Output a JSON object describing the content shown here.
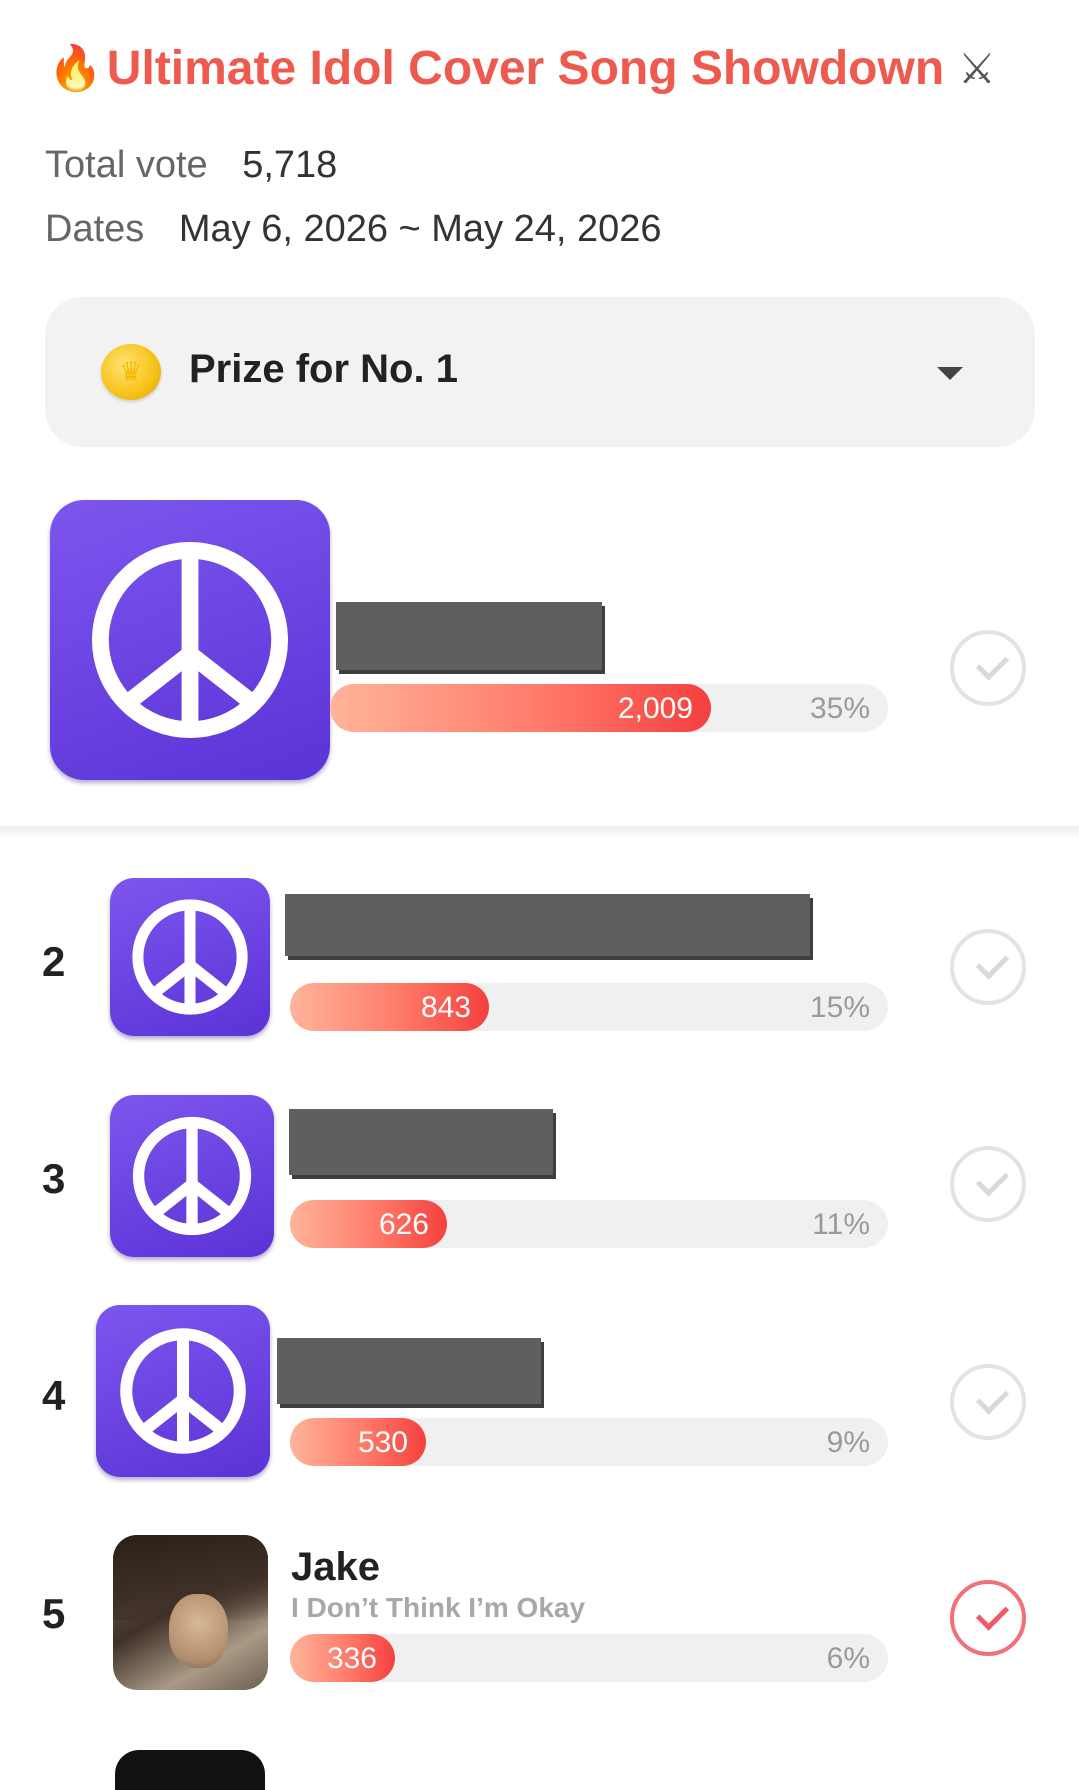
{
  "header": {
    "title": "Ultimate Idol Cover Song Showdown",
    "title_icon": "fire-icon",
    "title_trailing_icon": "crossed-swords-icon",
    "total_vote_label": "Total vote",
    "total_vote_value": "5,718",
    "dates_label": "Dates",
    "dates_value": "May 6, 2026 ~ May 24, 2026"
  },
  "prize": {
    "icon": "coin-icon",
    "label": "Prize for No. 1",
    "expand_icon": "caret-down-icon"
  },
  "colors": {
    "accent": "#ef5a4f",
    "bar_start": "#ffb49a",
    "bar_end": "#f4403e",
    "avatar_purple": "#6a3ee0",
    "check_selected": "#ef5a66"
  },
  "entries": [
    {
      "rank": "",
      "name": "",
      "song": "",
      "votes": "2,009",
      "percent": "35%",
      "share": 0.35,
      "avatar": "peace-sign",
      "redacted": true,
      "selected": false
    },
    {
      "rank": "2",
      "name": "",
      "song": "",
      "votes": "843",
      "percent": "15%",
      "share": 0.15,
      "avatar": "peace-sign",
      "redacted": true,
      "selected": false
    },
    {
      "rank": "3",
      "name": "",
      "song": "",
      "votes": "626",
      "percent": "11%",
      "share": 0.11,
      "avatar": "peace-sign",
      "redacted": true,
      "selected": false
    },
    {
      "rank": "4",
      "name": "",
      "song": "",
      "votes": "530",
      "percent": "9%",
      "share": 0.09,
      "avatar": "peace-sign",
      "redacted": true,
      "selected": false
    },
    {
      "rank": "5",
      "name": "Jake",
      "song": "I Don’t Think I’m Okay",
      "votes": "336",
      "percent": "6%",
      "share": 0.06,
      "avatar": "photo",
      "redacted": false,
      "selected": true
    }
  ]
}
